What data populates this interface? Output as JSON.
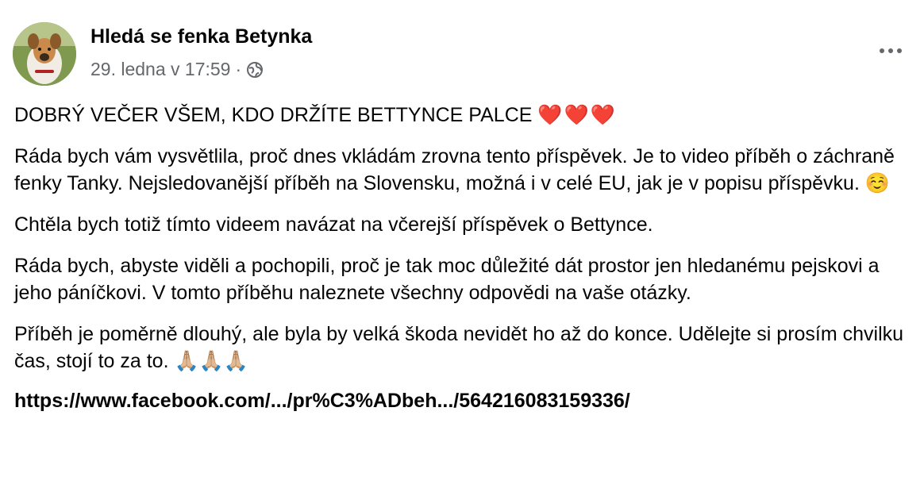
{
  "post": {
    "author": "Hledá se fenka Betynka",
    "timestamp": "29. ledna v 17:59",
    "separator": "·",
    "privacy_icon": "globe-icon",
    "more_icon": "more-options-icon",
    "paragraphs": [
      "DOBRÝ VEČER VŠEM, KDO DRŽÍTE BETTYNCE PALCE",
      "Ráda bych vám vysvětlila, proč dnes vkládám zrovna tento příspěvek. Je to video příběh o záchraně fenky Tanky. Nejsledovanější příběh na Slovensku, možná i v celé EU, jak je v popisu příspěvku.",
      "Chtěla bych totiž tímto videem navázat na včerejší příspěvek o Bettynce.",
      "Ráda bych, abyste viděli a pochopili, proč je tak moc důležité dát prostor jen hledanému pejskovi a jeho páníčkovi. V tomto příběhu naleznete všechny odpovědi na vaše otázky.",
      "Příběh je poměrně dlouhý, ale byla by velká škoda nevidět ho až do konce. Udělejte si prosím chvilku čas, stojí to za to."
    ],
    "emojis": {
      "hearts": "❤️❤️❤️",
      "smile": "☺️",
      "pray": "🙏🏼🙏🏼🙏🏼"
    },
    "link": "https://www.facebook.com/.../pr%C3%ADbeh.../564216083159336/"
  }
}
